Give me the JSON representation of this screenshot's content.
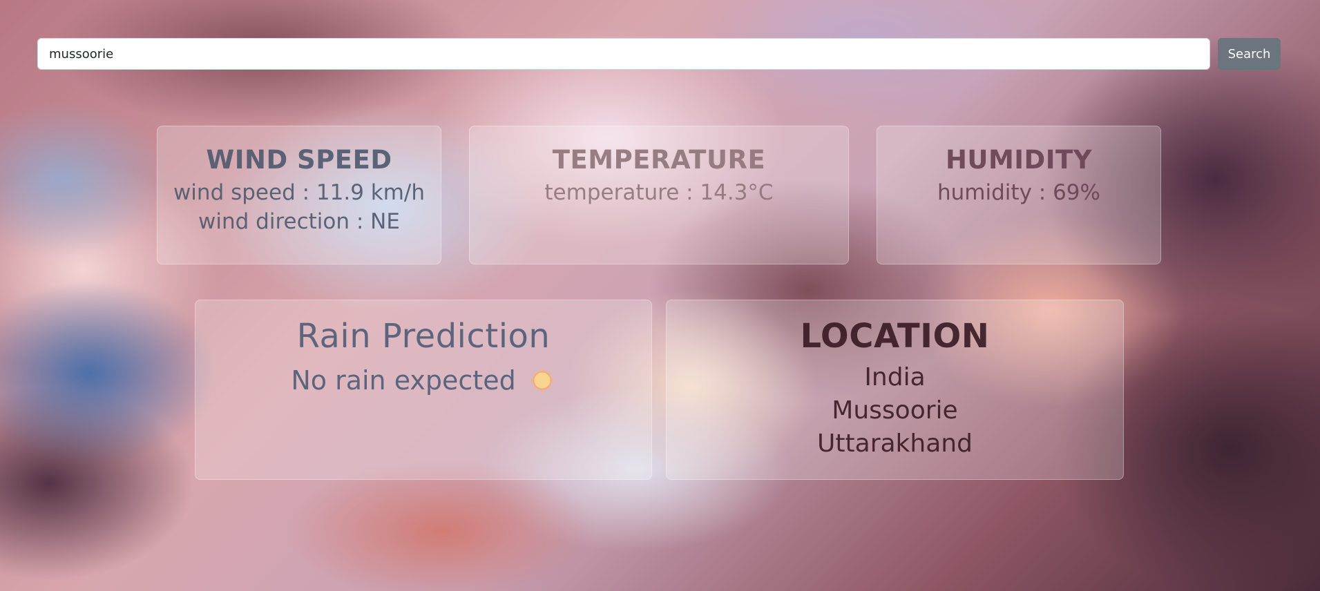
{
  "search": {
    "value": "mussoorie",
    "button_label": "Search"
  },
  "wind": {
    "title": "WIND SPEED",
    "speed_text": "wind speed : 11.9 km/h",
    "direction_text": "wind direction : NE"
  },
  "temperature": {
    "title": "TEMPERATURE",
    "value_text": "temperature : 14.3°C"
  },
  "humidity": {
    "title": "HUMIDITY",
    "value_text": "humidity : 69%"
  },
  "rain": {
    "title": "Rain Prediction",
    "status_text": "No rain expected",
    "icon": "sun-icon"
  },
  "location": {
    "title": "LOCATION",
    "country": "India",
    "city": "Mussoorie",
    "region": "Uttarakhand"
  },
  "colors": {
    "button": "#6c757d",
    "input_bg": "#ffffff"
  }
}
